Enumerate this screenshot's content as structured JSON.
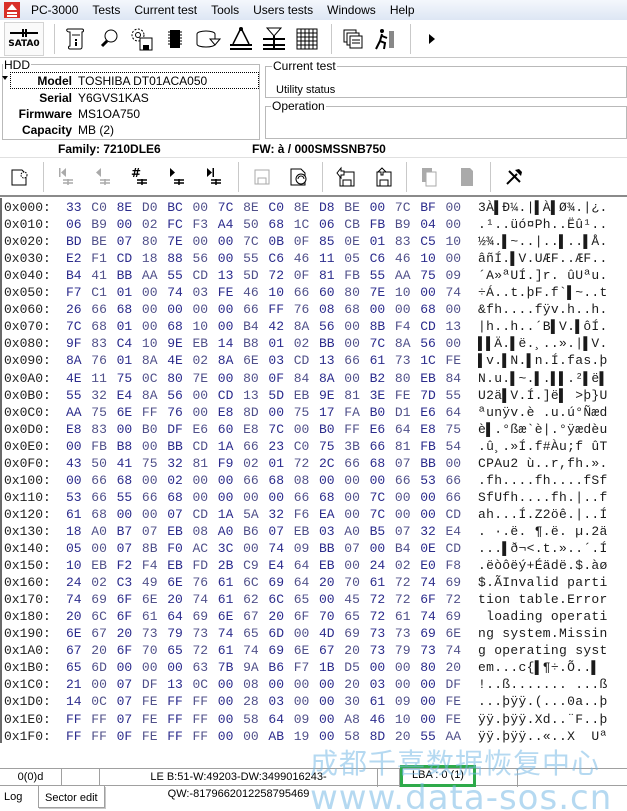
{
  "app": {
    "title": "PC-3000",
    "menu": [
      "Tests",
      "Current test",
      "Tools",
      "Users tests",
      "Windows",
      "Help"
    ]
  },
  "toolbar": {
    "port_label": "SATA0",
    "icons": [
      "hdd-info-icon",
      "lightbulb-icon",
      "gear-disk-icon",
      "chip-icon",
      "disk-arrow-icon",
      "compass-icon",
      "head-icon",
      "grid-icon",
      "windows-icon",
      "run-icon",
      "play-icon"
    ]
  },
  "hdd": {
    "legend": "HDD",
    "fields": [
      {
        "key": "Model",
        "value": "TOSHIBA DT01ACA050"
      },
      {
        "key": "Serial",
        "value": "Y6GVS1KAS"
      },
      {
        "key": "Firmware",
        "value": "MS1OA750"
      },
      {
        "key": "Capacity",
        "value": " MB (2)"
      }
    ],
    "family": "Family: 7210DLE6",
    "fw": "FW: à   / 000SMSSNB750"
  },
  "current_test": {
    "legend": "Current test",
    "utility_status": "Utility status"
  },
  "operation": {
    "legend": "Operation"
  },
  "sector_toolbar": {
    "icons": [
      "new-sector-icon",
      "first-sector-icon",
      "prev-sector-icon",
      "goto-sector-icon",
      "next-sector-icon",
      "last-sector-icon",
      "save-icon",
      "reload-icon",
      "save-to-file-icon",
      "load-from-file-icon",
      "copy-icon",
      "paste-icon",
      "tools-icon"
    ]
  },
  "hex": {
    "rows": [
      {
        "offset": "0x000:",
        "bytes": [
          "33",
          "C0",
          "8E",
          "D0",
          "BC",
          "00",
          "7C",
          "8E",
          "C0",
          "8E",
          "D8",
          "BE",
          "00",
          "7C",
          "BF",
          "00"
        ],
        "ascii": "3À▌Ð¼.|▌À▌Ø¾.|¿."
      },
      {
        "offset": "0x010:",
        "bytes": [
          "06",
          "B9",
          "00",
          "02",
          "FC",
          "F3",
          "A4",
          "50",
          "68",
          "1C",
          "06",
          "CB",
          "FB",
          "B9",
          "04",
          "00"
        ],
        "ascii": ".¹..üó¤Ph..Ëû¹.."
      },
      {
        "offset": "0x020:",
        "bytes": [
          "BD",
          "BE",
          "07",
          "80",
          "7E",
          "00",
          "00",
          "7C",
          "0B",
          "0F",
          "85",
          "0E",
          "01",
          "83",
          "C5",
          "10"
        ],
        "ascii": "½¾.▌~..|..▌..▌Å."
      },
      {
        "offset": "0x030:",
        "bytes": [
          "E2",
          "F1",
          "CD",
          "18",
          "88",
          "56",
          "00",
          "55",
          "C6",
          "46",
          "11",
          "05",
          "C6",
          "46",
          "10",
          "00"
        ],
        "ascii": "âñÍ.▌V.UÆF..ÆF.."
      },
      {
        "offset": "0x040:",
        "bytes": [
          "B4",
          "41",
          "BB",
          "AA",
          "55",
          "CD",
          "13",
          "5D",
          "72",
          "0F",
          "81",
          "FB",
          "55",
          "AA",
          "75",
          "09"
        ],
        "ascii": "´A»ªUÍ.]r. ûUªu."
      },
      {
        "offset": "0x050:",
        "bytes": [
          "F7",
          "C1",
          "01",
          "00",
          "74",
          "03",
          "FE",
          "46",
          "10",
          "66",
          "60",
          "80",
          "7E",
          "10",
          "00",
          "74"
        ],
        "ascii": "÷Á..t.þF.f`▌~..t"
      },
      {
        "offset": "0x060:",
        "bytes": [
          "26",
          "66",
          "68",
          "00",
          "00",
          "00",
          "00",
          "66",
          "FF",
          "76",
          "08",
          "68",
          "00",
          "00",
          "68",
          "00"
        ],
        "ascii": "&fh....fÿv.h..h."
      },
      {
        "offset": "0x070:",
        "bytes": [
          "7C",
          "68",
          "01",
          "00",
          "68",
          "10",
          "00",
          "B4",
          "42",
          "8A",
          "56",
          "00",
          "8B",
          "F4",
          "CD",
          "13"
        ],
        "ascii": "|h..h..´B▌V.▌ôÍ."
      },
      {
        "offset": "0x080:",
        "bytes": [
          "9F",
          "83",
          "C4",
          "10",
          "9E",
          "EB",
          "14",
          "B8",
          "01",
          "02",
          "BB",
          "00",
          "7C",
          "8A",
          "56",
          "00"
        ],
        "ascii": "▌▌Ä.▌ë.¸..».|▌V."
      },
      {
        "offset": "0x090:",
        "bytes": [
          "8A",
          "76",
          "01",
          "8A",
          "4E",
          "02",
          "8A",
          "6E",
          "03",
          "CD",
          "13",
          "66",
          "61",
          "73",
          "1C",
          "FE"
        ],
        "ascii": "▌v.▌N.▌n.Í.fas.þ"
      },
      {
        "offset": "0x0A0:",
        "bytes": [
          "4E",
          "11",
          "75",
          "0C",
          "80",
          "7E",
          "00",
          "80",
          "0F",
          "84",
          "8A",
          "00",
          "B2",
          "80",
          "EB",
          "84"
        ],
        "ascii": "N.u.▌~.▌.▌▌.²▌ë▌"
      },
      {
        "offset": "0x0B0:",
        "bytes": [
          "55",
          "32",
          "E4",
          "8A",
          "56",
          "00",
          "CD",
          "13",
          "5D",
          "EB",
          "9E",
          "81",
          "3E",
          "FE",
          "7D",
          "55"
        ],
        "ascii": "U2ä▌V.Í.]ë▌ >þ}U"
      },
      {
        "offset": "0x0C0:",
        "bytes": [
          "AA",
          "75",
          "6E",
          "FF",
          "76",
          "00",
          "E8",
          "8D",
          "00",
          "75",
          "17",
          "FA",
          "B0",
          "D1",
          "E6",
          "64"
        ],
        "ascii": "ªunÿv.è .u.ú°Ñæd"
      },
      {
        "offset": "0x0D0:",
        "bytes": [
          "E8",
          "83",
          "00",
          "B0",
          "DF",
          "E6",
          "60",
          "E8",
          "7C",
          "00",
          "B0",
          "FF",
          "E6",
          "64",
          "E8",
          "75"
        ],
        "ascii": "è▌.°ßæ`è|.°ÿædèu"
      },
      {
        "offset": "0x0E0:",
        "bytes": [
          "00",
          "FB",
          "B8",
          "00",
          "BB",
          "CD",
          "1A",
          "66",
          "23",
          "C0",
          "75",
          "3B",
          "66",
          "81",
          "FB",
          "54"
        ],
        "ascii": ".û¸.»Í.f#Àu;f ûT"
      },
      {
        "offset": "0x0F0:",
        "bytes": [
          "43",
          "50",
          "41",
          "75",
          "32",
          "81",
          "F9",
          "02",
          "01",
          "72",
          "2C",
          "66",
          "68",
          "07",
          "BB",
          "00"
        ],
        "ascii": "CPAu2 ù..r,fh.»."
      },
      {
        "offset": "0x100:",
        "bytes": [
          "00",
          "66",
          "68",
          "00",
          "02",
          "00",
          "00",
          "66",
          "68",
          "08",
          "00",
          "00",
          "00",
          "66",
          "53",
          "66"
        ],
        "ascii": ".fh....fh....fSf"
      },
      {
        "offset": "0x110:",
        "bytes": [
          "53",
          "66",
          "55",
          "66",
          "68",
          "00",
          "00",
          "00",
          "00",
          "66",
          "68",
          "00",
          "7C",
          "00",
          "00",
          "66"
        ],
        "ascii": "SfUfh....fh.|..f"
      },
      {
        "offset": "0x120:",
        "bytes": [
          "61",
          "68",
          "00",
          "00",
          "07",
          "CD",
          "1A",
          "5A",
          "32",
          "F6",
          "EA",
          "00",
          "7C",
          "00",
          "00",
          "CD"
        ],
        "ascii": "ah...Í.Z2öê.|..Í"
      },
      {
        "offset": "0x130:",
        "bytes": [
          "18",
          "A0",
          "B7",
          "07",
          "EB",
          "08",
          "A0",
          "B6",
          "07",
          "EB",
          "03",
          "A0",
          "B5",
          "07",
          "32",
          "E4"
        ],
        "ascii": ". ·.ë. ¶.ë. µ.2ä"
      },
      {
        "offset": "0x140:",
        "bytes": [
          "05",
          "00",
          "07",
          "8B",
          "F0",
          "AC",
          "3C",
          "00",
          "74",
          "09",
          "BB",
          "07",
          "00",
          "B4",
          "0E",
          "CD"
        ],
        "ascii": "...▌ð¬<.t.»..´.Í"
      },
      {
        "offset": "0x150:",
        "bytes": [
          "10",
          "EB",
          "F2",
          "F4",
          "EB",
          "FD",
          "2B",
          "C9",
          "E4",
          "64",
          "EB",
          "00",
          "24",
          "02",
          "E0",
          "F8"
        ],
        "ascii": ".ëòôëý+Éädë.$.àø"
      },
      {
        "offset": "0x160:",
        "bytes": [
          "24",
          "02",
          "C3",
          "49",
          "6E",
          "76",
          "61",
          "6C",
          "69",
          "64",
          "20",
          "70",
          "61",
          "72",
          "74",
          "69"
        ],
        "ascii": "$.ÃInvalid parti"
      },
      {
        "offset": "0x170:",
        "bytes": [
          "74",
          "69",
          "6F",
          "6E",
          "20",
          "74",
          "61",
          "62",
          "6C",
          "65",
          "00",
          "45",
          "72",
          "72",
          "6F",
          "72"
        ],
        "ascii": "tion table.Error"
      },
      {
        "offset": "0x180:",
        "bytes": [
          "20",
          "6C",
          "6F",
          "61",
          "64",
          "69",
          "6E",
          "67",
          "20",
          "6F",
          "70",
          "65",
          "72",
          "61",
          "74",
          "69"
        ],
        "ascii": " loading operati"
      },
      {
        "offset": "0x190:",
        "bytes": [
          "6E",
          "67",
          "20",
          "73",
          "79",
          "73",
          "74",
          "65",
          "6D",
          "00",
          "4D",
          "69",
          "73",
          "73",
          "69",
          "6E"
        ],
        "ascii": "ng system.Missin"
      },
      {
        "offset": "0x1A0:",
        "bytes": [
          "67",
          "20",
          "6F",
          "70",
          "65",
          "72",
          "61",
          "74",
          "69",
          "6E",
          "67",
          "20",
          "73",
          "79",
          "73",
          "74"
        ],
        "ascii": "g operating syst"
      },
      {
        "offset": "0x1B0:",
        "bytes": [
          "65",
          "6D",
          "00",
          "00",
          "00",
          "63",
          "7B",
          "9A",
          "B6",
          "F7",
          "1B",
          "D5",
          "00",
          "00",
          "80",
          "20"
        ],
        "ascii": "em...c{▌¶÷.Õ..▌ "
      },
      {
        "offset": "0x1C0:",
        "bytes": [
          "21",
          "00",
          "07",
          "DF",
          "13",
          "0C",
          "00",
          "08",
          "00",
          "00",
          "00",
          "20",
          "03",
          "00",
          "00",
          "DF"
        ],
        "ascii": "!..ß....... ...ß"
      },
      {
        "offset": "0x1D0:",
        "bytes": [
          "14",
          "0C",
          "07",
          "FE",
          "FF",
          "FF",
          "00",
          "28",
          "03",
          "00",
          "00",
          "30",
          "61",
          "09",
          "00",
          "FE"
        ],
        "ascii": "...þÿÿ.(...0a..þ"
      },
      {
        "offset": "0x1E0:",
        "bytes": [
          "FF",
          "FF",
          "07",
          "FE",
          "FF",
          "FF",
          "00",
          "58",
          "64",
          "09",
          "00",
          "A8",
          "46",
          "10",
          "00",
          "FE"
        ],
        "ascii": "ÿÿ.þÿÿ.Xd..¨F..þ"
      },
      {
        "offset": "0x1F0:",
        "bytes": [
          "FF",
          "FF",
          "0F",
          "FE",
          "FF",
          "FF",
          "00",
          "00",
          "AB",
          "19",
          "00",
          "58",
          "8D",
          "20",
          "55",
          "AA"
        ],
        "ascii": "ÿÿ.þÿÿ..«..X  Uª"
      }
    ]
  },
  "statusbar": {
    "position": "0(0)d",
    "empty": "",
    "values": "LE B:51-W:49203-DW:3499016243-QW:-8179662012258795469",
    "empty2": "",
    "lba": "LBA : 0 (1)",
    "lba_color": "#2eaa4a"
  },
  "tabs": [
    {
      "label": "Log",
      "active": false
    },
    {
      "label": "Sector edit",
      "active": true
    }
  ],
  "watermark": {
    "line1": "成都千喜数据恢复中心",
    "line2": "www.data-sos.cn"
  }
}
